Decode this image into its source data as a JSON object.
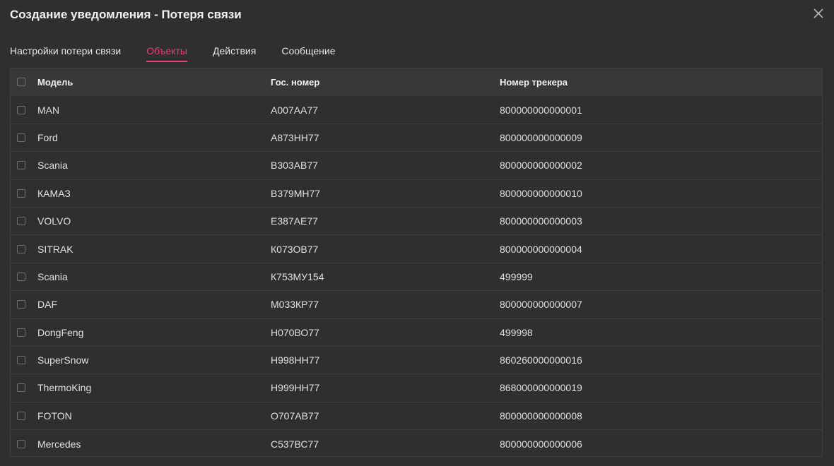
{
  "dialog": {
    "title": "Создание уведомления - Потеря связи",
    "close_icon": "close-icon"
  },
  "tabs": [
    {
      "label": "Настройки потери связи",
      "active": false
    },
    {
      "label": "Объекты",
      "active": true
    },
    {
      "label": "Действия",
      "active": false
    },
    {
      "label": "Сообщение",
      "active": false
    }
  ],
  "colors": {
    "accent": "#e5407f",
    "background": "#2f2f2f",
    "header_bg": "#383838"
  },
  "table": {
    "columns": [
      "Модель",
      "Гос. номер",
      "Номер трекера"
    ],
    "rows": [
      {
        "model": "MAN",
        "plate": "А007АА77",
        "tracker": "800000000000001"
      },
      {
        "model": "Ford",
        "plate": "А873НН77",
        "tracker": "800000000000009"
      },
      {
        "model": "Scania",
        "plate": "В303АВ77",
        "tracker": "800000000000002"
      },
      {
        "model": "КАМАЗ",
        "plate": "В379МН77",
        "tracker": "800000000000010"
      },
      {
        "model": "VOLVO",
        "plate": "Е387АЕ77",
        "tracker": "800000000000003"
      },
      {
        "model": "SITRAK",
        "plate": "К073ОВ77",
        "tracker": "800000000000004"
      },
      {
        "model": "Scania",
        "plate": "К753МУ154",
        "tracker": "499999"
      },
      {
        "model": "DAF",
        "plate": "М033КР77",
        "tracker": "800000000000007"
      },
      {
        "model": "DongFeng",
        "plate": "Н070ВО77",
        "tracker": "499998"
      },
      {
        "model": "SuperSnow",
        "plate": "Н998НН77",
        "tracker": "860260000000016"
      },
      {
        "model": "ThermoKing",
        "plate": "Н999НН77",
        "tracker": "868000000000019"
      },
      {
        "model": "FOTON",
        "plate": "О707АВ77",
        "tracker": "800000000000008"
      },
      {
        "model": "Mercedes",
        "plate": "С537ВС77",
        "tracker": "800000000000006"
      }
    ]
  }
}
